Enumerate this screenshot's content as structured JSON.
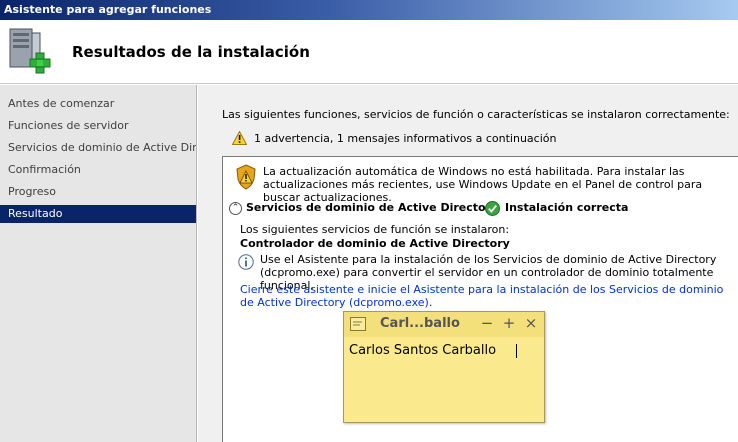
{
  "window": {
    "title": "Asistente para agregar funciones"
  },
  "header": {
    "title": "Resultados de la instalación",
    "icon": "server-add-icon"
  },
  "sidebar": {
    "items": [
      {
        "label": "Antes de comenzar",
        "active": false
      },
      {
        "label": "Funciones de servidor",
        "active": false
      },
      {
        "label": "Servicios de dominio de Active Dir...",
        "active": false
      },
      {
        "label": "Confirmación",
        "active": false
      },
      {
        "label": "Progreso",
        "active": false
      },
      {
        "label": "Resultado",
        "active": true
      }
    ]
  },
  "main": {
    "intro": "Las siguientes funciones, servicios de función o características se instalaron correctamente:",
    "summary": "1 advertencia, 1 mensajes informativos a continuación",
    "update_note": "La actualización automática de Windows no está habilitada. Para instalar las actualizaciones más recientes, use Windows Update en el Panel de control para buscar actualizaciones.",
    "service": {
      "name": "Servicios de dominio de Active Directory",
      "status": "Instalación correcta",
      "installed_label": "Los siguientes servicios de función se instalaron:",
      "role_service": "Controlador de dominio de Active Directory",
      "info": "Use el Asistente para la instalación de los Servicios de dominio de Active Directory (dcpromo.exe) para convertir el servidor en un controlador de dominio totalmente funcional.",
      "link": "Cierre este asistente e inicie el Asistente para la instalación de los Servicios de dominio de Active Directory (dcpromo.exe)."
    }
  },
  "sticky_note": {
    "title": "Carl...ballo",
    "minimize": "−",
    "add": "+",
    "close": "×",
    "text": "Carlos Santos Carballo",
    "color": "#fbe98d"
  },
  "colors": {
    "titlebar_start": "#0a246a",
    "sidebar_active": "#0a246a",
    "link": "#0033cc"
  }
}
